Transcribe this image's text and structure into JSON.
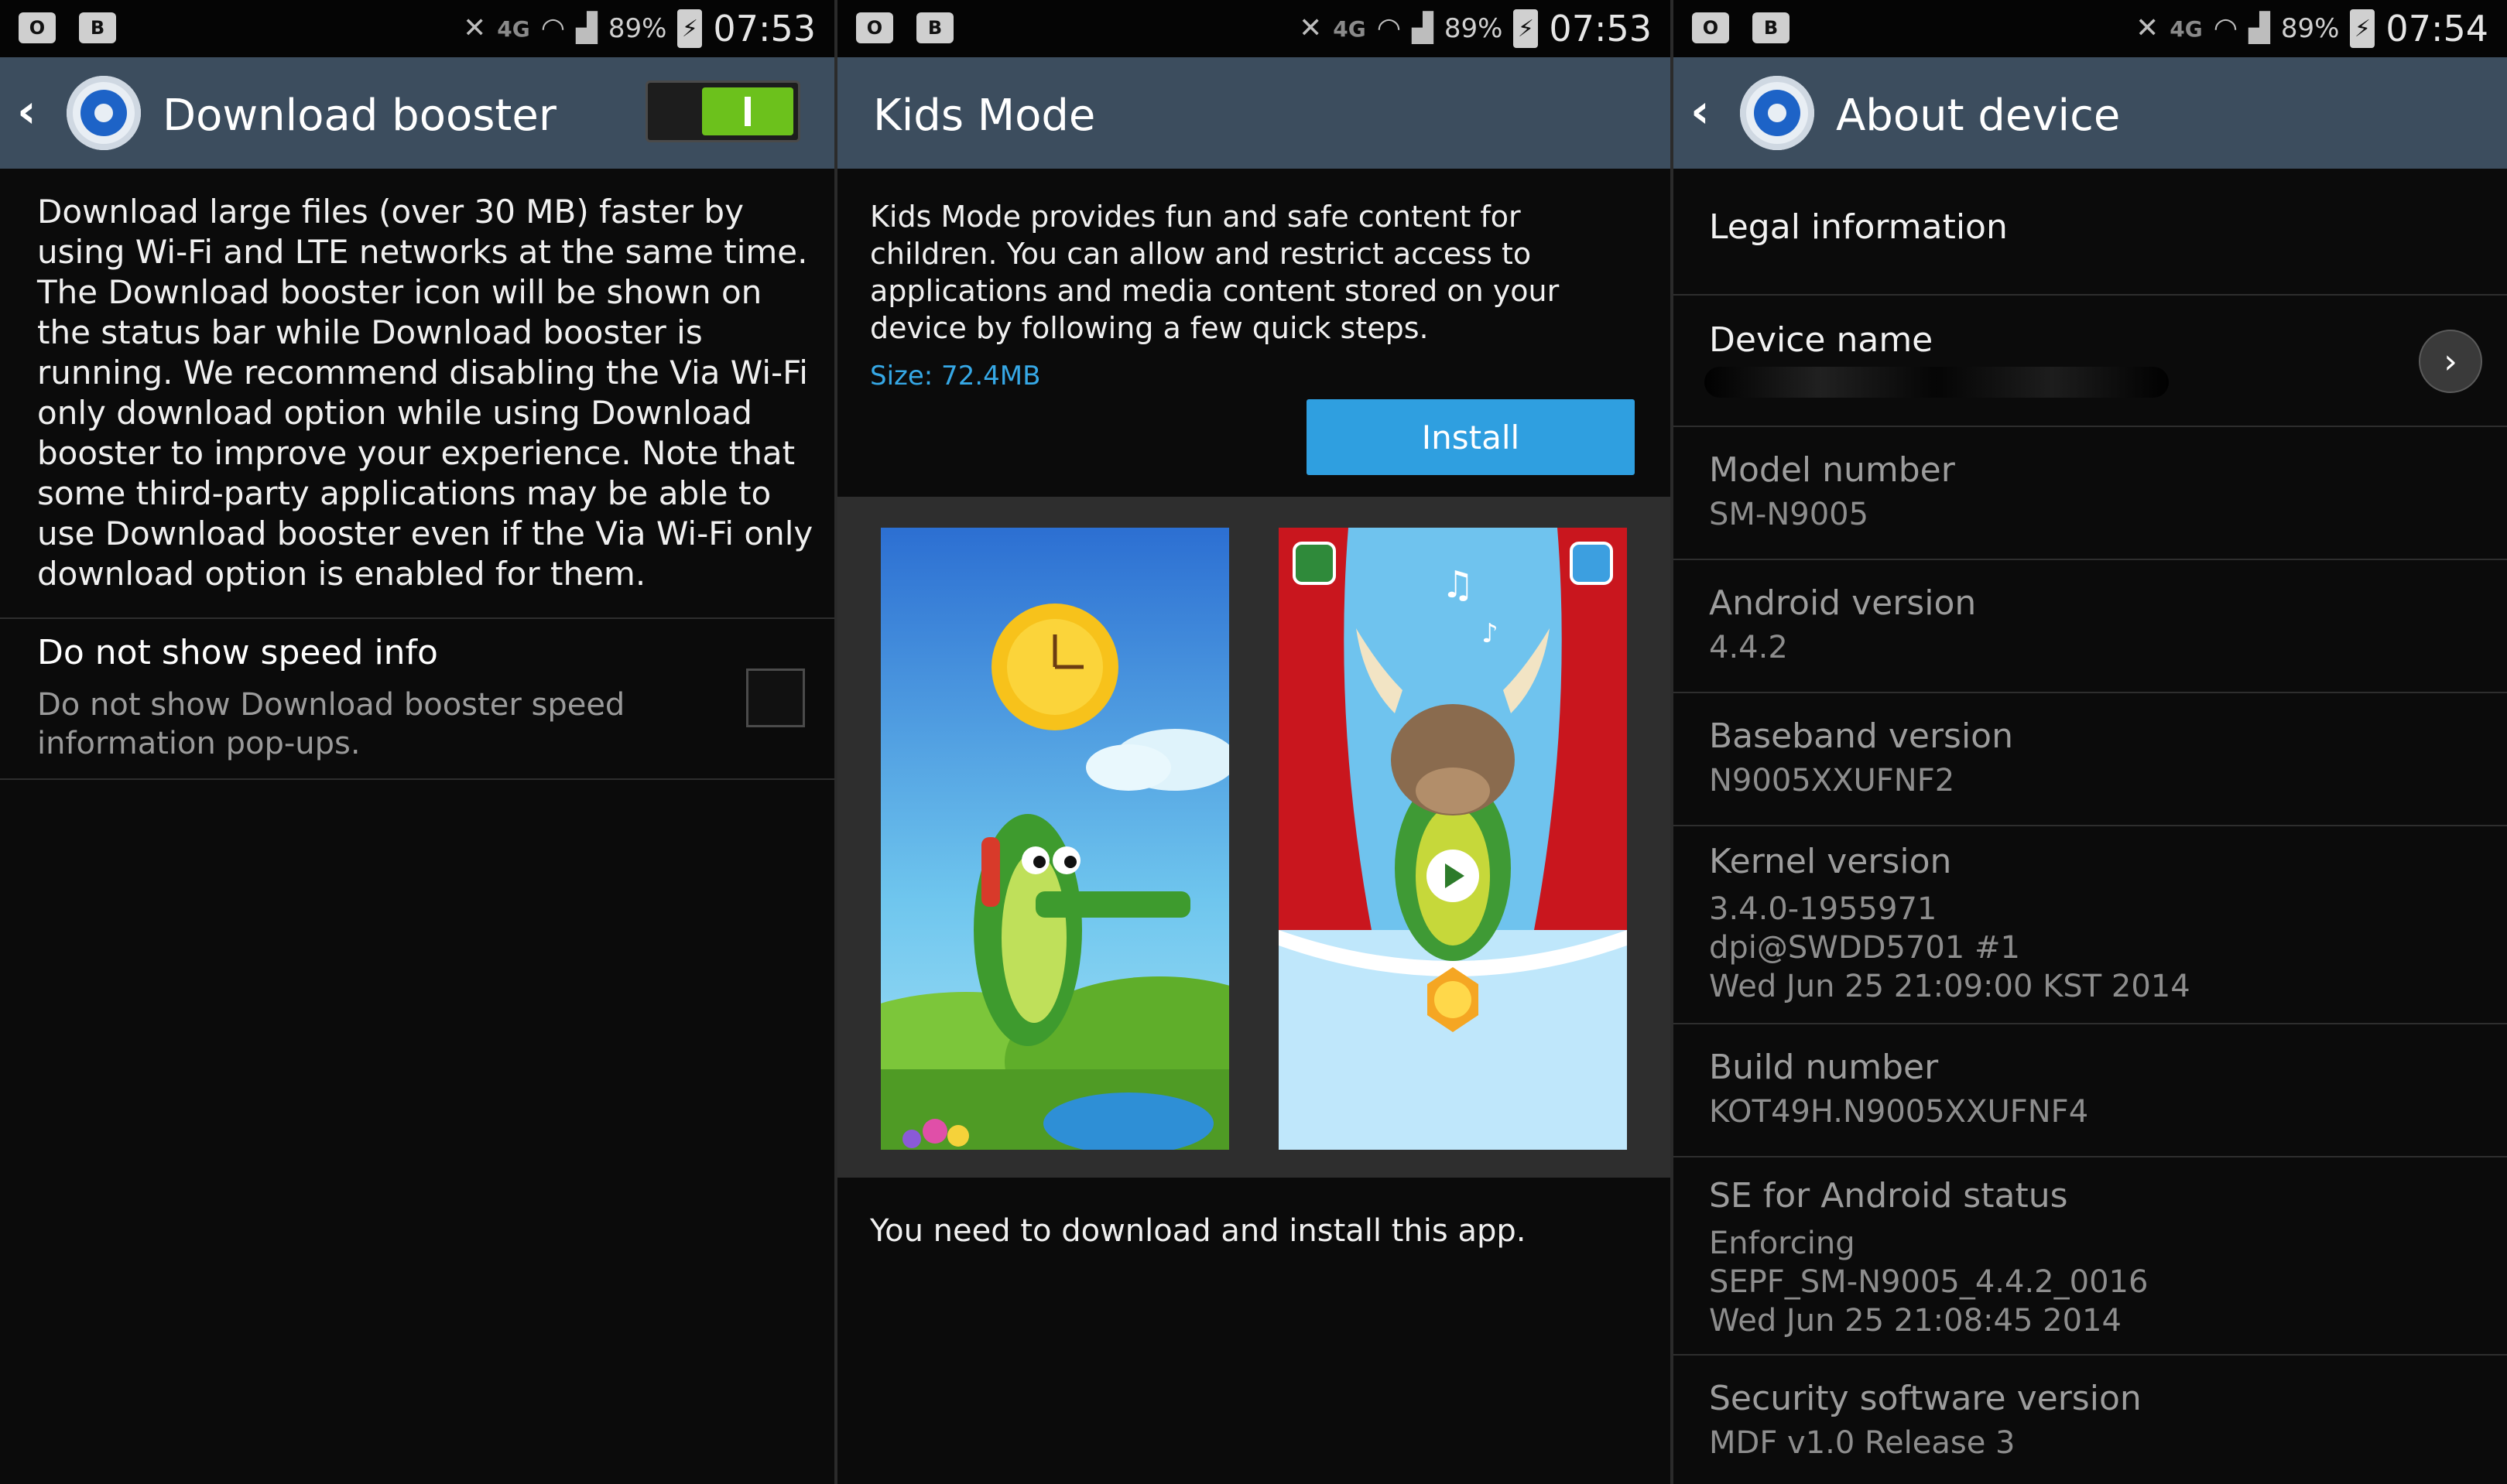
{
  "status_bars": [
    {
      "battery": "89%",
      "time": "07:53",
      "network": "4G"
    },
    {
      "battery": "89%",
      "time": "07:53",
      "network": "4G"
    },
    {
      "battery": "89%",
      "time": "07:54",
      "network": "4G"
    }
  ],
  "colors": {
    "action_bar": "#3c4d5e",
    "accent_blue": "#2f9fe0",
    "toggle_on": "#6cc11c",
    "background": "#0b0b0b"
  },
  "panel1": {
    "title": "Download booster",
    "toggle_on": true,
    "description": "Download large files (over 30 MB) faster by using Wi-Fi and LTE networks at the same time. The Download booster icon will be shown on the status bar while Download booster is running. We recommend disabling the Via Wi-Fi only download option while using Download booster to improve your experience. Note that some third-party applications may be able to use Download booster even if the Via Wi-Fi only download option is enabled for them.",
    "option_title": "Do not show speed info",
    "option_subtitle": "Do not show Download booster speed information pop-ups.",
    "option_checked": false
  },
  "panel2": {
    "title": "Kids Mode",
    "description": "Kids Mode provides fun and safe content for children. You can allow and restrict access to applications and media content stored on your device by following a few quick steps.",
    "size": "Size: 72.4MB",
    "install_label": "Install",
    "note": "You need to download and install this app."
  },
  "panel3": {
    "title": "About device",
    "items": [
      {
        "label": "Legal information",
        "value": ""
      },
      {
        "label": "Device name",
        "value": ""
      },
      {
        "label": "Model number",
        "value": "SM-N9005"
      },
      {
        "label": "Android version",
        "value": "4.4.2"
      },
      {
        "label": "Baseband version",
        "value": "N9005XXUFNF2"
      },
      {
        "label": "Kernel version",
        "value": "3.4.0-1955971\ndpi@SWDD5701 #1\nWed Jun 25 21:09:00 KST 2014"
      },
      {
        "label": "Build number",
        "value": "KOT49H.N9005XXUFNF4"
      },
      {
        "label": "SE for Android status",
        "value": "Enforcing\nSEPF_SM-N9005_4.4.2_0016\nWed Jun 25 21:08:45 2014"
      },
      {
        "label": "Security software version",
        "value": "MDF v1.0 Release 3"
      }
    ]
  }
}
